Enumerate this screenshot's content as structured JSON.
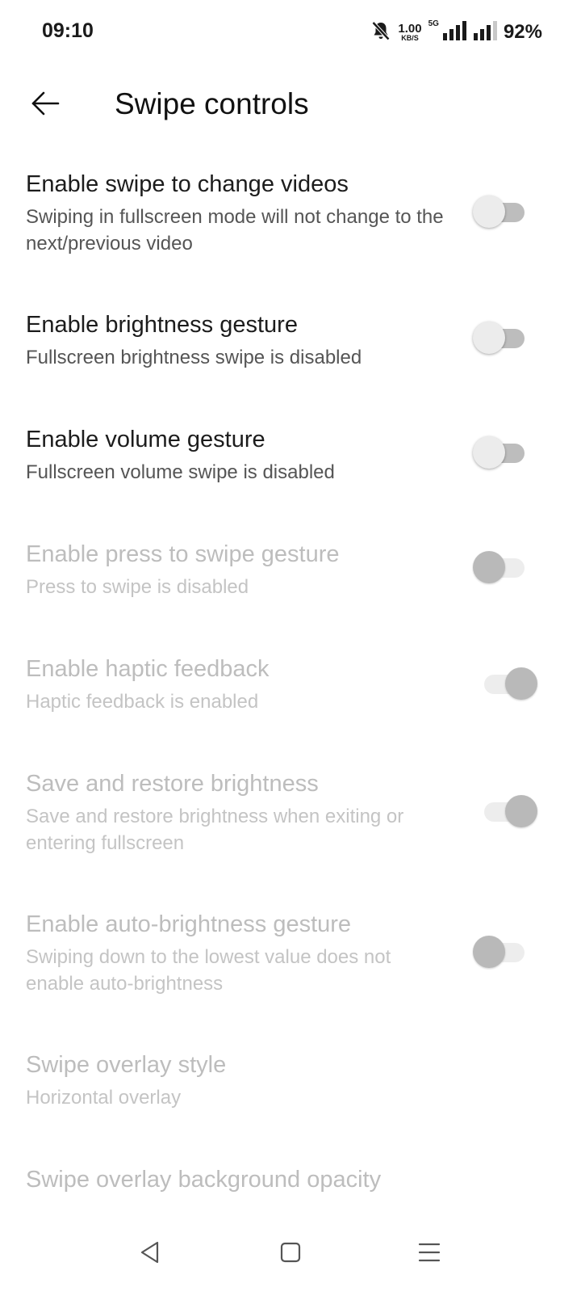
{
  "status_bar": {
    "time": "09:10",
    "net_speed_value": "1.00",
    "net_speed_unit": "KB/S",
    "network_type": "5G",
    "battery": "92%",
    "icons": [
      "mute-bell-icon",
      "signal-icon",
      "battery-icon"
    ]
  },
  "header": {
    "title": "Swipe controls",
    "back_icon": "arrow-left-icon"
  },
  "settings": [
    {
      "title": "Enable swipe to change videos",
      "description": "Swiping in fullscreen mode will not change to the next/previous video",
      "toggle": "off",
      "enabled": true
    },
    {
      "title": "Enable brightness gesture",
      "description": "Fullscreen brightness swipe is disabled",
      "toggle": "off",
      "enabled": true
    },
    {
      "title": "Enable volume gesture",
      "description": "Fullscreen volume swipe is disabled",
      "toggle": "off",
      "enabled": true
    },
    {
      "title": "Enable press to swipe gesture",
      "description": "Press to swipe is disabled",
      "toggle": "off",
      "enabled": false
    },
    {
      "title": "Enable haptic feedback",
      "description": "Haptic feedback is enabled",
      "toggle": "on",
      "enabled": false
    },
    {
      "title": "Save and restore brightness",
      "description": "Save and restore brightness when exiting or entering fullscreen",
      "toggle": "on",
      "enabled": false
    },
    {
      "title": "Enable auto-brightness gesture",
      "description": "Swiping down to the lowest value does not enable auto-brightness",
      "toggle": "off",
      "enabled": false
    },
    {
      "title": "Swipe overlay style",
      "description": "Horizontal overlay",
      "enabled": false
    },
    {
      "title": "Swipe overlay background opacity",
      "enabled": false
    }
  ],
  "nav_bar": {
    "icons": [
      "nav-back-icon",
      "nav-home-icon",
      "nav-recents-icon"
    ]
  },
  "colors": {
    "text_primary": "#1c1c1c",
    "text_secondary": "#555555",
    "text_disabled": "#bdbdbd",
    "background": "#ffffff"
  }
}
